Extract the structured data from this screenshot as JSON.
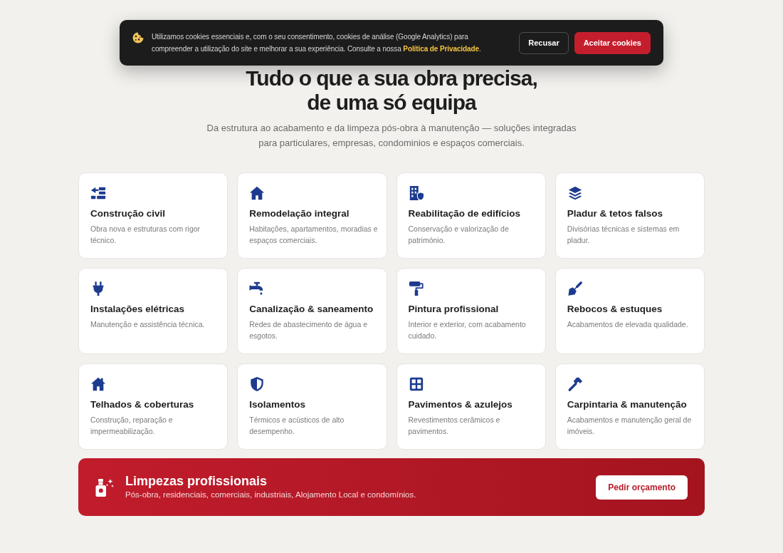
{
  "cookie_banner": {
    "message": "Utilizamos cookies essenciais e, com o seu consentimento, cookies de análise (Google Analytics) para compreender a utilização do site e melhorar a sua experiência. Consulte a nossa",
    "link": "Política de Privacidade",
    "message_end": ".",
    "buttons": [
      {
        "label": "Recusar",
        "kind": "secondary"
      },
      {
        "label": "Aceitar cookies",
        "kind": "primary"
      }
    ]
  },
  "hero": {
    "title_lines": [
      "Tudo o que a sua obra precisa,",
      "de uma só equipa"
    ],
    "subtitle": "Da estrutura ao acabamento e da limpeza pós-obra à manutenção — soluções integradas para particulares, empresas, condominios e espaços comerciais."
  },
  "services": [
    {
      "title": "Construção civil",
      "description": "Obra nova e estruturas com rigor técnico."
    },
    {
      "title": "Remodelação integral",
      "description": "Habitações, apartamentos, moradias e espaços comerciais."
    },
    {
      "title": "Reabilitação de edifícios",
      "description": "Conservação e valorização de património."
    },
    {
      "title": "Pladur & tetos falsos",
      "description": "Divisórias técnicas e sistemas em pladur."
    },
    {
      "title": "Instalações elétricas",
      "description": "Manutenção e assistência técnica."
    },
    {
      "title": "Canalização & saneamento",
      "description": "Redes de abastecimento de água e esgotos."
    },
    {
      "title": "Pintura profissional",
      "description": "Interior e exterior, com acabamento cuidado."
    },
    {
      "title": "Rebocos & estuques",
      "description": "Acabamentos de elevada qualidade."
    },
    {
      "title": "Telhados & coberturas",
      "description": "Construção, reparação e impermeabilização."
    },
    {
      "title": "Isolamentos",
      "description": "Térmicos e acústicos de alto desempenho."
    },
    {
      "title": "Pavimentos & azulejos",
      "description": "Revestimentos cerâmicos e pavimentos."
    },
    {
      "title": "Carpintaria & manutenção",
      "description": "Acabamentos e manutenção geral de imóveis."
    }
  ],
  "cleaning_banner": {
    "title": "Limpezas profissionais",
    "description": "Pós-obra, residenciais, comerciais, industriais, Alojamento Local e condomínios.",
    "button": "Pedir orçamento"
  }
}
